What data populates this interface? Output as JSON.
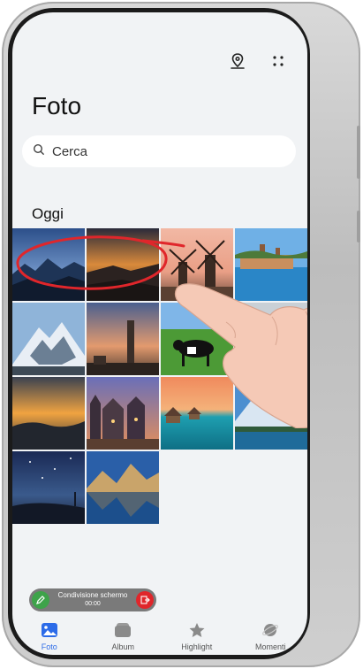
{
  "app": {
    "title": "Foto"
  },
  "search": {
    "placeholder": "Cerca"
  },
  "section": {
    "today_label": "Oggi"
  },
  "photos": [
    {
      "name": "photo-mountain-night"
    },
    {
      "name": "photo-sunset-hills"
    },
    {
      "name": "photo-windmills"
    },
    {
      "name": "photo-lake-town"
    },
    {
      "name": "photo-snowy-peak"
    },
    {
      "name": "photo-tower-sunset"
    },
    {
      "name": "photo-cow-meadow"
    },
    {
      "name": "photo-grey-sea"
    },
    {
      "name": "photo-orange-clouds"
    },
    {
      "name": "photo-old-town-street"
    },
    {
      "name": "photo-water-bungalows"
    },
    {
      "name": "photo-alpine-lake"
    },
    {
      "name": "photo-starry-coast"
    },
    {
      "name": "photo-blue-mountain-lake"
    }
  ],
  "screen_share": {
    "title": "Condivisione schermo",
    "time": "00:00"
  },
  "tabs": [
    {
      "label": "Foto",
      "icon": "photo-icon",
      "active": true
    },
    {
      "label": "Album",
      "icon": "album-icon",
      "active": false
    },
    {
      "label": "Highlight",
      "icon": "star-icon",
      "active": false
    },
    {
      "label": "Momenti",
      "icon": "planet-icon",
      "active": false
    }
  ],
  "colors": {
    "accent": "#2c6be8",
    "background": "#f1f3f5",
    "annotation": "#e0262b"
  }
}
